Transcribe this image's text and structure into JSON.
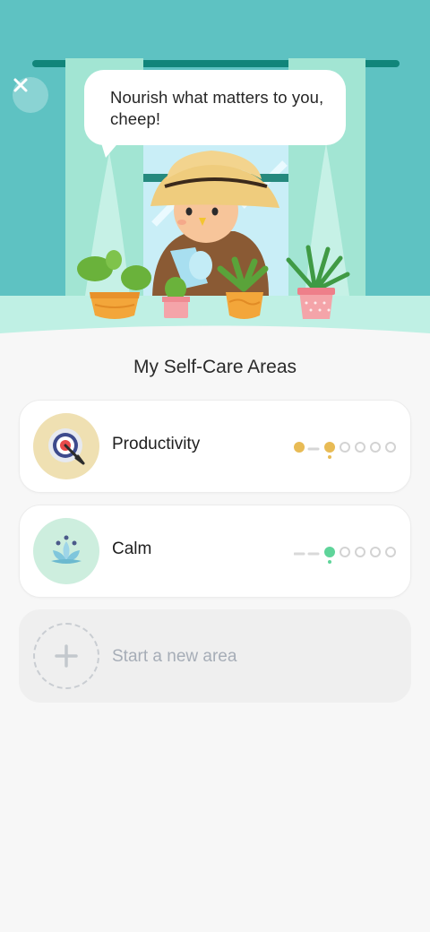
{
  "header": {
    "speech_bubble": "Nourish what matters to you, cheep!",
    "close_icon": "close-icon"
  },
  "section": {
    "title": "My Self-Care Areas"
  },
  "areas": [
    {
      "name": "Productivity",
      "icon": "target-icon",
      "accent": "#e8bb55",
      "icon_bg": "#efe0b2",
      "completed_steps": 2,
      "current_step": 2,
      "total_steps": 7
    },
    {
      "name": "Calm",
      "icon": "lotus-icon",
      "accent": "#5fd49a",
      "icon_bg": "#cdeede",
      "completed_steps": 0,
      "current_step": 2,
      "total_steps": 7
    }
  ],
  "new_area": {
    "label": "Start a new area",
    "icon": "plus-icon"
  },
  "colors": {
    "hero_bg": "#5ec2c2",
    "page_bg": "#f7f7f7",
    "curtain": "#9be3d1"
  }
}
